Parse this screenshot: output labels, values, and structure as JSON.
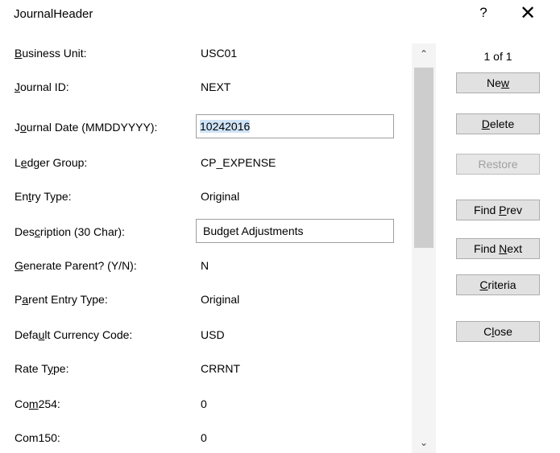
{
  "window": {
    "title": "JournalHeader",
    "help_label": "?",
    "close_label": "✕"
  },
  "fields": [
    {
      "label_pre": "",
      "label_key": "B",
      "label_post": "usiness Unit:",
      "value": "USC01"
    },
    {
      "label_pre": "",
      "label_key": "J",
      "label_post": "ournal ID:",
      "value": "NEXT"
    },
    {
      "label_pre": "J",
      "label_key": "o",
      "label_post": "urnal Date (MMDDYYYY):",
      "value": "10242016"
    },
    {
      "label_pre": "L",
      "label_key": "e",
      "label_post": "dger Group:",
      "value": "CP_EXPENSE"
    },
    {
      "label_pre": "En",
      "label_key": "t",
      "label_post": "ry Type:",
      "value": "Original"
    },
    {
      "label_pre": "Des",
      "label_key": "c",
      "label_post": "ription (30 Char):",
      "value": "Budget Adjustments"
    },
    {
      "label_pre": "",
      "label_key": "G",
      "label_post": "enerate Parent? (Y/N):",
      "value": "N"
    },
    {
      "label_pre": "P",
      "label_key": "a",
      "label_post": "rent Entry Type:",
      "value": "Original"
    },
    {
      "label_pre": "Defa",
      "label_key": "u",
      "label_post": "lt Currency Code:",
      "value": "USD"
    },
    {
      "label_pre": "Rate T",
      "label_key": "y",
      "label_post": "pe:",
      "value": "CRRNT"
    },
    {
      "label_pre": "Co",
      "label_key": "m",
      "label_post": "254:",
      "value": "0"
    },
    {
      "label_pre": "Com150:",
      "label_key": "",
      "label_post": "",
      "value": "0"
    }
  ],
  "record_counter": "1 of 1",
  "buttons": {
    "new": {
      "pre": "Ne",
      "key": "w",
      "post": ""
    },
    "delete": {
      "pre": "",
      "key": "D",
      "post": "elete"
    },
    "restore": {
      "pre": "Restore",
      "key": "",
      "post": ""
    },
    "find_prev": {
      "pre": "Find ",
      "key": "P",
      "post": "rev"
    },
    "find_next": {
      "pre": "Find ",
      "key": "N",
      "post": "ext"
    },
    "criteria": {
      "pre": "",
      "key": "C",
      "post": "riteria"
    },
    "close": {
      "pre": "C",
      "key": "l",
      "post": "ose"
    }
  },
  "scrollbar": {
    "up_glyph": "⌃",
    "down_glyph": "⌄"
  },
  "colors": {
    "button_bg": "#e1e1e1",
    "selection": "#cfe3f7",
    "disabled_text": "#a0a0a0"
  }
}
